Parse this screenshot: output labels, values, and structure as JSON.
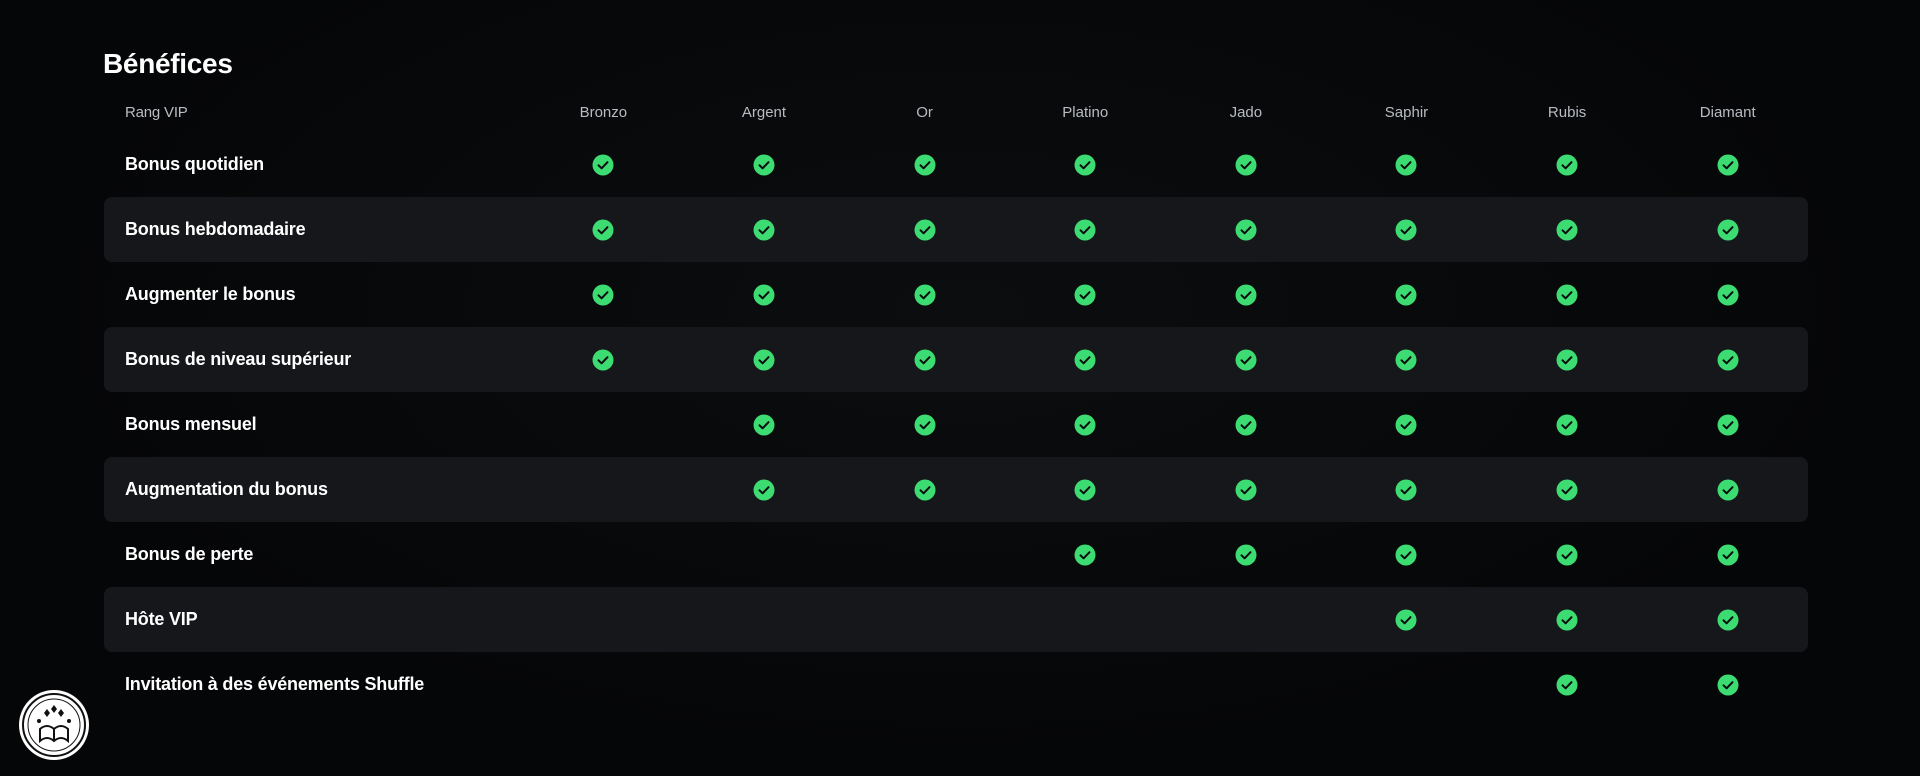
{
  "title": "Bénéfices",
  "header": {
    "label": "Rang VIP",
    "tiers": [
      "Bronzo",
      "Argent",
      "Or",
      "Platino",
      "Jado",
      "Saphir",
      "Rubis",
      "Diamant"
    ]
  },
  "rows": [
    {
      "label": "Bonus quotidien",
      "checks": [
        true,
        true,
        true,
        true,
        true,
        true,
        true,
        true
      ]
    },
    {
      "label": "Bonus hebdomadaire",
      "checks": [
        true,
        true,
        true,
        true,
        true,
        true,
        true,
        true
      ]
    },
    {
      "label": "Augmenter le bonus",
      "checks": [
        true,
        true,
        true,
        true,
        true,
        true,
        true,
        true
      ]
    },
    {
      "label": "Bonus de niveau supérieur",
      "checks": [
        true,
        true,
        true,
        true,
        true,
        true,
        true,
        true
      ]
    },
    {
      "label": "Bonus mensuel",
      "checks": [
        false,
        true,
        true,
        true,
        true,
        true,
        true,
        true
      ]
    },
    {
      "label": "Augmentation du bonus",
      "checks": [
        false,
        true,
        true,
        true,
        true,
        true,
        true,
        true
      ]
    },
    {
      "label": "Bonus de perte",
      "checks": [
        false,
        false,
        false,
        true,
        true,
        true,
        true,
        true
      ]
    },
    {
      "label": "Hôte VIP",
      "checks": [
        false,
        false,
        false,
        false,
        false,
        true,
        true,
        true
      ]
    },
    {
      "label": "Invitation à des événements Shuffle",
      "checks": [
        false,
        false,
        false,
        false,
        false,
        false,
        true,
        true
      ]
    }
  ],
  "colors": {
    "check": "#3ddc72",
    "row_alt": "#15171a",
    "background": "#050607"
  },
  "icons": {
    "check": "check-circle-icon",
    "logo": "book-of-bonus-logo"
  },
  "logo": {
    "text": "BOOK OF BONUS"
  }
}
